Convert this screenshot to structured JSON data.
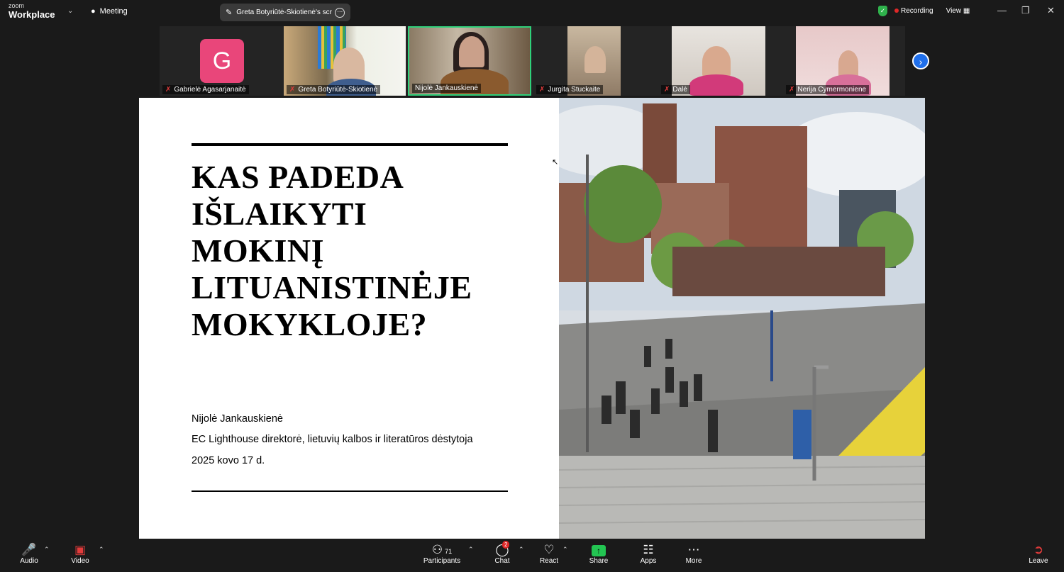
{
  "app": {
    "logo_top": "zoom",
    "logo_bottom": "Workplace"
  },
  "topbar": {
    "meeting_label": "Meeting",
    "share_label": "Greta Botyriūtė-Skiotienė's screen",
    "recording_label": "Recording",
    "view_label": "View"
  },
  "participants": [
    {
      "name": "Gabrielė Agasarjanaitė",
      "muted": true,
      "initial": "G"
    },
    {
      "name": "Greta Botyriūtė-Skiotienė",
      "muted": true
    },
    {
      "name": "Nijolė Jankauskienė",
      "muted": false,
      "active_speaker": true
    },
    {
      "name": "Jurgita Stuckaite",
      "muted": true
    },
    {
      "name": "Dalė",
      "muted": true
    },
    {
      "name": "Nerija Cymermoniene",
      "muted": true
    }
  ],
  "slide": {
    "title_lines": [
      "KAS PADEDA",
      "IŠLAIKYTI",
      "MOKINĮ",
      "LITUANISTINĖJE",
      "MOKYKLOJE?"
    ],
    "author": "Nijolė Jankauskienė",
    "position": "EC Lighthouse direktorė, lietuvių kalbos ir literatūros dėstytoja",
    "date": "2025 kovo 17 d."
  },
  "toolbar": {
    "audio": "Audio",
    "video": "Video",
    "participants": "Participants",
    "participants_count": "71",
    "chat": "Chat",
    "chat_badge": "2",
    "react": "React",
    "share": "Share",
    "apps": "Apps",
    "more": "More",
    "leave": "Leave"
  },
  "colors": {
    "accent_green": "#23c552",
    "recording_red": "#e02828",
    "avatar_pink": "#e9467a",
    "speaker_border": "#2fd07a",
    "next_blue": "#1f6feb"
  }
}
